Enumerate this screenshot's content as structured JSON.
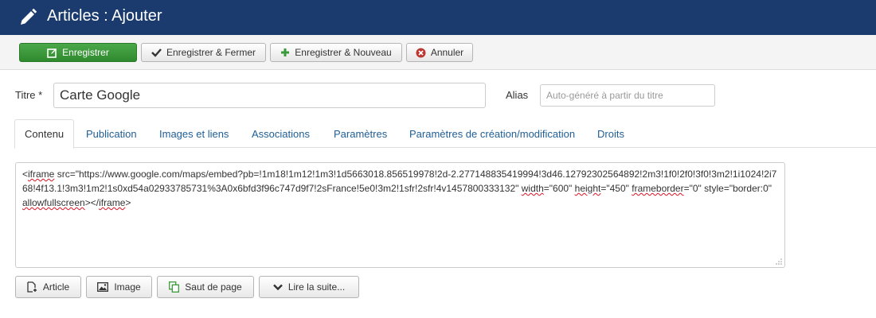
{
  "header": {
    "title": "Articles : Ajouter",
    "icon": "pencil-icon",
    "bg_color": "#1b3b6f"
  },
  "toolbar": {
    "save": "Enregistrer",
    "save_close": "Enregistrer & Fermer",
    "save_new": "Enregistrer & Nouveau",
    "cancel": "Annuler",
    "save_color": "#3a9a39"
  },
  "form": {
    "title_label": "Titre *",
    "title_value": "Carte Google",
    "alias_label": "Alias",
    "alias_placeholder": "Auto-généré à partir du titre"
  },
  "tabs": [
    {
      "label": "Contenu",
      "active": true
    },
    {
      "label": "Publication"
    },
    {
      "label": "Images et liens"
    },
    {
      "label": "Associations"
    },
    {
      "label": "Paramètres"
    },
    {
      "label": "Paramètres de création/modification"
    },
    {
      "label": "Droits"
    }
  ],
  "editor": {
    "parts": [
      "<",
      "iframe",
      " src=\"https://www.google.com/maps/embed?pb=!1m18!1m12!1m3!1d5663018.856519978!2d-2.277148835419994!3d46.12792302564892!2m3!1f0!2f0!3f0!3m2!1i1024!2i768!4f13.1!3m3!1m2!1s0xd54a02933785731%3A0x6bfd3f96c747d9f7!2sFrance!5e0!3m2!1sfr!2sfr!4v1457800333132\" ",
      "width",
      "=\"600\" ",
      "height",
      "=\"450\" ",
      "frameborder",
      "=\"0\" style=\"border:0\" ",
      "allowfullscreen",
      "></",
      "iframe",
      ">"
    ]
  },
  "editor_buttons": {
    "article": "Article",
    "image": "Image",
    "pagebreak": "Saut de page",
    "readmore": "Lire la suite..."
  }
}
